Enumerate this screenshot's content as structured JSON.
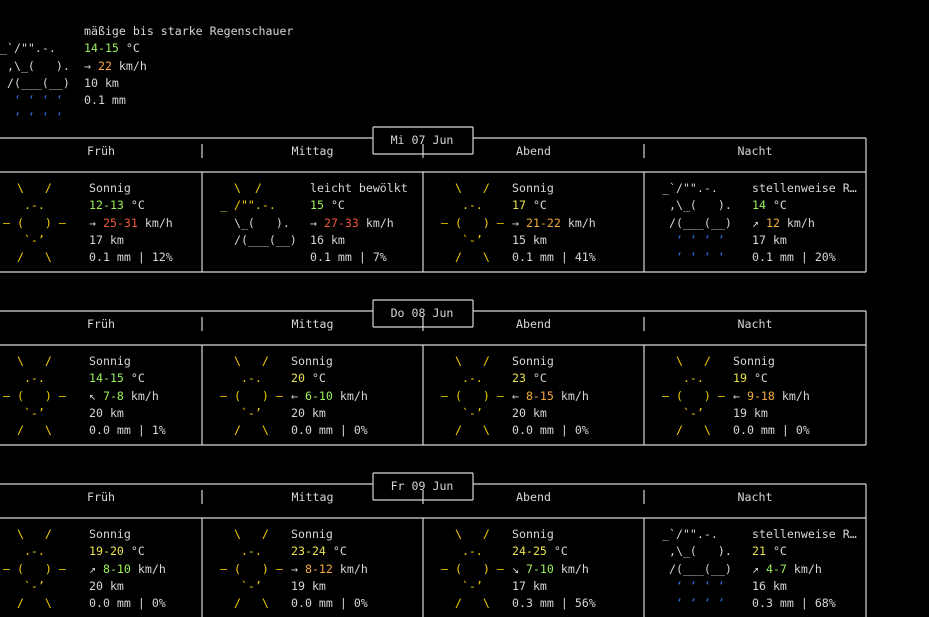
{
  "current": {
    "icon_lines": [
      "_`/\"\".-.",
      " ,\\_(   ).",
      " /(___(__)",
      "  ‘ ‘ ‘ ‘",
      "  ‘ ‘ ‘ ‘"
    ],
    "description": "mäßige bis starke Regenschauer",
    "temp": "14-15",
    "temp_unit": "°C",
    "wind_arrow": "→",
    "wind": "22",
    "wind_unit": "km/h",
    "visibility": "10 km",
    "precip": "0.1 mm"
  },
  "days": [
    {
      "label": "Mi 07 Jun",
      "periods": [
        {
          "name": "Früh",
          "icon": "sun",
          "desc": "Sonnig",
          "temp": "12-13",
          "unit": "°C",
          "arrow": "→",
          "wind": "25-31",
          "wind_unit": "km/h",
          "vis": "17 km",
          "precip": "0.1 mm | 12%"
        },
        {
          "name": "Mittag",
          "icon": "partly",
          "desc": "leicht bewölkt",
          "temp": "15",
          "unit": "°C",
          "arrow": "→",
          "wind": "27-33",
          "wind_unit": "km/h",
          "vis": "16 km",
          "precip": "0.1 mm | 7%"
        },
        {
          "name": "Abend",
          "icon": "sun",
          "desc": "Sonnig",
          "temp": "17",
          "unit": "°C",
          "arrow": "→",
          "wind": "21-22",
          "wind_unit": "km/h",
          "vis": "15 km",
          "precip": "0.1 mm | 41%"
        },
        {
          "name": "Nacht",
          "icon": "rain",
          "desc": "stellenweise R…",
          "temp": "14",
          "unit": "°C",
          "arrow": "↗",
          "wind": "12",
          "wind_unit": "km/h",
          "vis": "17 km",
          "precip": "0.1 mm | 20%"
        }
      ]
    },
    {
      "label": "Do 08 Jun",
      "periods": [
        {
          "name": "Früh",
          "icon": "sun",
          "desc": "Sonnig",
          "temp": "14-15",
          "unit": "°C",
          "arrow": "↖",
          "wind": "7-8",
          "wind_unit": "km/h",
          "vis": "20 km",
          "precip": "0.0 mm | 1%"
        },
        {
          "name": "Mittag",
          "icon": "sun",
          "desc": "Sonnig",
          "temp": "20",
          "unit": "°C",
          "arrow": "←",
          "wind": "6-10",
          "wind_unit": "km/h",
          "vis": "20 km",
          "precip": "0.0 mm | 0%"
        },
        {
          "name": "Abend",
          "icon": "sun",
          "desc": "Sonnig",
          "temp": "23",
          "unit": "°C",
          "arrow": "←",
          "wind": "8-15",
          "wind_unit": "km/h",
          "vis": "20 km",
          "precip": "0.0 mm | 0%"
        },
        {
          "name": "Nacht",
          "icon": "sun",
          "desc": "Sonnig",
          "temp": "19",
          "unit": "°C",
          "arrow": "←",
          "wind": "9-18",
          "wind_unit": "km/h",
          "vis": "19 km",
          "precip": "0.0 mm | 0%"
        }
      ]
    },
    {
      "label": "Fr 09 Jun",
      "periods": [
        {
          "name": "Früh",
          "icon": "sun",
          "desc": "Sonnig",
          "temp": "19-20",
          "unit": "°C",
          "arrow": "↗",
          "wind": "8-10",
          "wind_unit": "km/h",
          "vis": "20 km",
          "precip": "0.0 mm | 0%"
        },
        {
          "name": "Mittag",
          "icon": "sun",
          "desc": "Sonnig",
          "temp": "23-24",
          "unit": "°C",
          "arrow": "→",
          "wind": "8-12",
          "wind_unit": "km/h",
          "vis": "19 km",
          "precip": "0.0 mm | 0%"
        },
        {
          "name": "Abend",
          "icon": "sun",
          "desc": "Sonnig",
          "temp": "24-25",
          "unit": "°C",
          "arrow": "↘",
          "wind": "7-10",
          "wind_unit": "km/h",
          "vis": "17 km",
          "precip": "0.3 mm | 56%"
        },
        {
          "name": "Nacht",
          "icon": "rain",
          "desc": "stellenweise R…",
          "temp": "21",
          "unit": "°C",
          "arrow": "↗",
          "wind": "4-7",
          "wind_unit": "km/h",
          "vis": "16 km",
          "precip": "0.3 mm | 68%"
        }
      ]
    }
  ],
  "icons": {
    "sun": [
      "  \\   /",
      "   .-.",
      "― (   ) ―",
      "   `-’",
      "  /   \\"
    ],
    "partly": [
      "  \\  /",
      "_ /\"\".-.",
      "  \\_(   ).",
      "  /(___(__)",
      ""
    ],
    "rain": [
      "_`/\"\".-.",
      " ,\\_(   ).",
      " /(___(__)",
      "  ‘ ‘ ‘ ‘",
      "  ‘ ‘ ‘ ‘"
    ]
  },
  "colors": {
    "background": "#000000",
    "text": "#d6d6d6",
    "sun": "#f5d000",
    "rain": "#2d6bd8",
    "temp_cool": "#9bf05a",
    "temp_warm": "#e8e24c",
    "wind_mid": "#f3a93c",
    "wind_high": "#f0563a"
  }
}
